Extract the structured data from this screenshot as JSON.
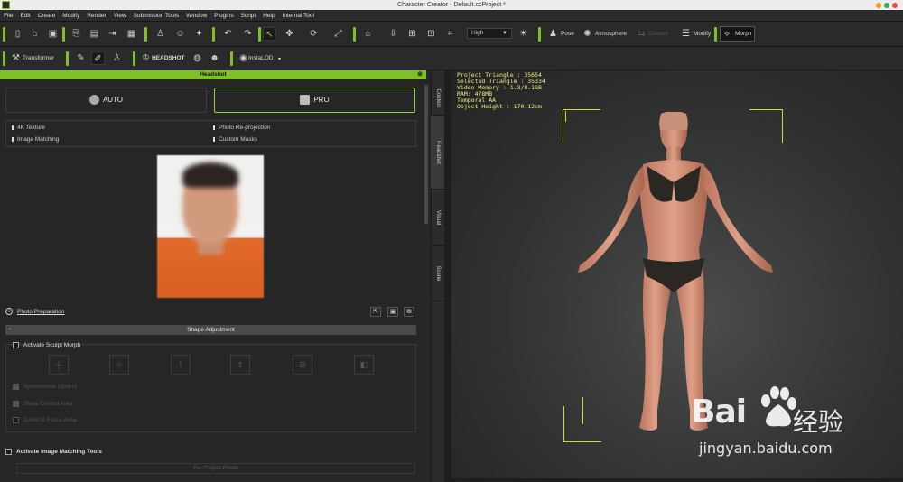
{
  "window": {
    "title": "Character Creator - Default.ccProject *"
  },
  "menu": [
    "File",
    "Edit",
    "Create",
    "Modify",
    "Render",
    "View",
    "Submission Tools",
    "Window",
    "Plugins",
    "Script",
    "Help",
    "Internal Tool"
  ],
  "toolbar": {
    "quality": "High",
    "pose_label": "Pose",
    "atmosphere_label": "Atmosphere",
    "custom_label": "Custom",
    "modify_label": "Modify",
    "morph_label": "Morph",
    "transformer_label": "Transformer",
    "headshot_label": "HEADSHOT",
    "instalod_label": "InstaLOD"
  },
  "panel": {
    "title": "Headshot",
    "modes": {
      "auto": "AUTO",
      "pro": "PRO"
    },
    "features": [
      "4K Texture",
      "Photo Re-projection",
      "Image Matching",
      "Custom Masks"
    ],
    "photo_preparation": "Photo Preparation",
    "shape_adjustment": "Shape Adjustment",
    "activate_sculpt_morph": "Activate Sculpt Morph",
    "symmetrical": "Symmetrical (Shift+)",
    "show_control_area": "Show Control Area",
    "zoom_to_focus_area": "Zoom to Focus Area",
    "activate_image_matching": "Activate Image Matching Tools",
    "reproject_photo": "Re-Project Photo",
    "side_tabs": [
      "Content",
      "Headshot",
      "Visual",
      "Scene"
    ]
  },
  "viewport": {
    "stats": [
      "Project Triangle : 35654",
      "Selected Triangle : 35334",
      "Video Memory : 1.3/8.1GB",
      "RAM: 478MB",
      "Temporal AA",
      "Object Height : 170.12cm"
    ]
  },
  "watermark": {
    "main": "Bai",
    "cn": "经验",
    "url": "jingyan.baidu.com"
  },
  "colors": {
    "accent": "#7dc02a",
    "stats_text": "#f5f07a",
    "orange_shirt": "#e26a2c"
  }
}
